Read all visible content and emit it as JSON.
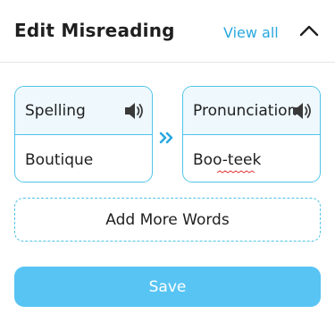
{
  "header": {
    "title": "Edit Misreading",
    "view_all_label": "View all",
    "collapse_icon": "chevron-up-icon"
  },
  "entry": {
    "spelling_label": "Spelling",
    "spelling_value": "Boutique",
    "pronunciation_label": "Pronunciation",
    "pronunciation_value": "Boo-teek",
    "speaker_icon": "speaker-icon",
    "arrow_icon": "double-chevron-right-icon"
  },
  "actions": {
    "add_more_label": "Add More Words",
    "save_label": "Save"
  },
  "colors": {
    "accent": "#4fc3e8",
    "link": "#2aa8e0",
    "save_button": "#58c4f4",
    "card_header_bg": "#eef8fd"
  }
}
